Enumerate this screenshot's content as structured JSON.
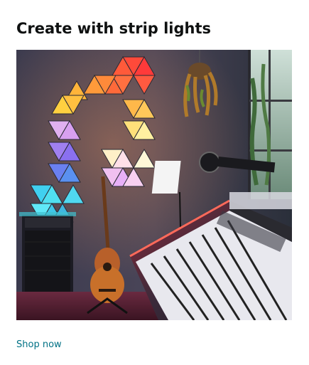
{
  "card": {
    "title": "Create with strip lights",
    "image_subject": "music-note-shaped-triangle-light-panels-with-keyboard-and-guitar",
    "link_label": "Shop now"
  },
  "colors": {
    "title": "#0f1111",
    "link": "#007185",
    "background": "#ffffff"
  }
}
